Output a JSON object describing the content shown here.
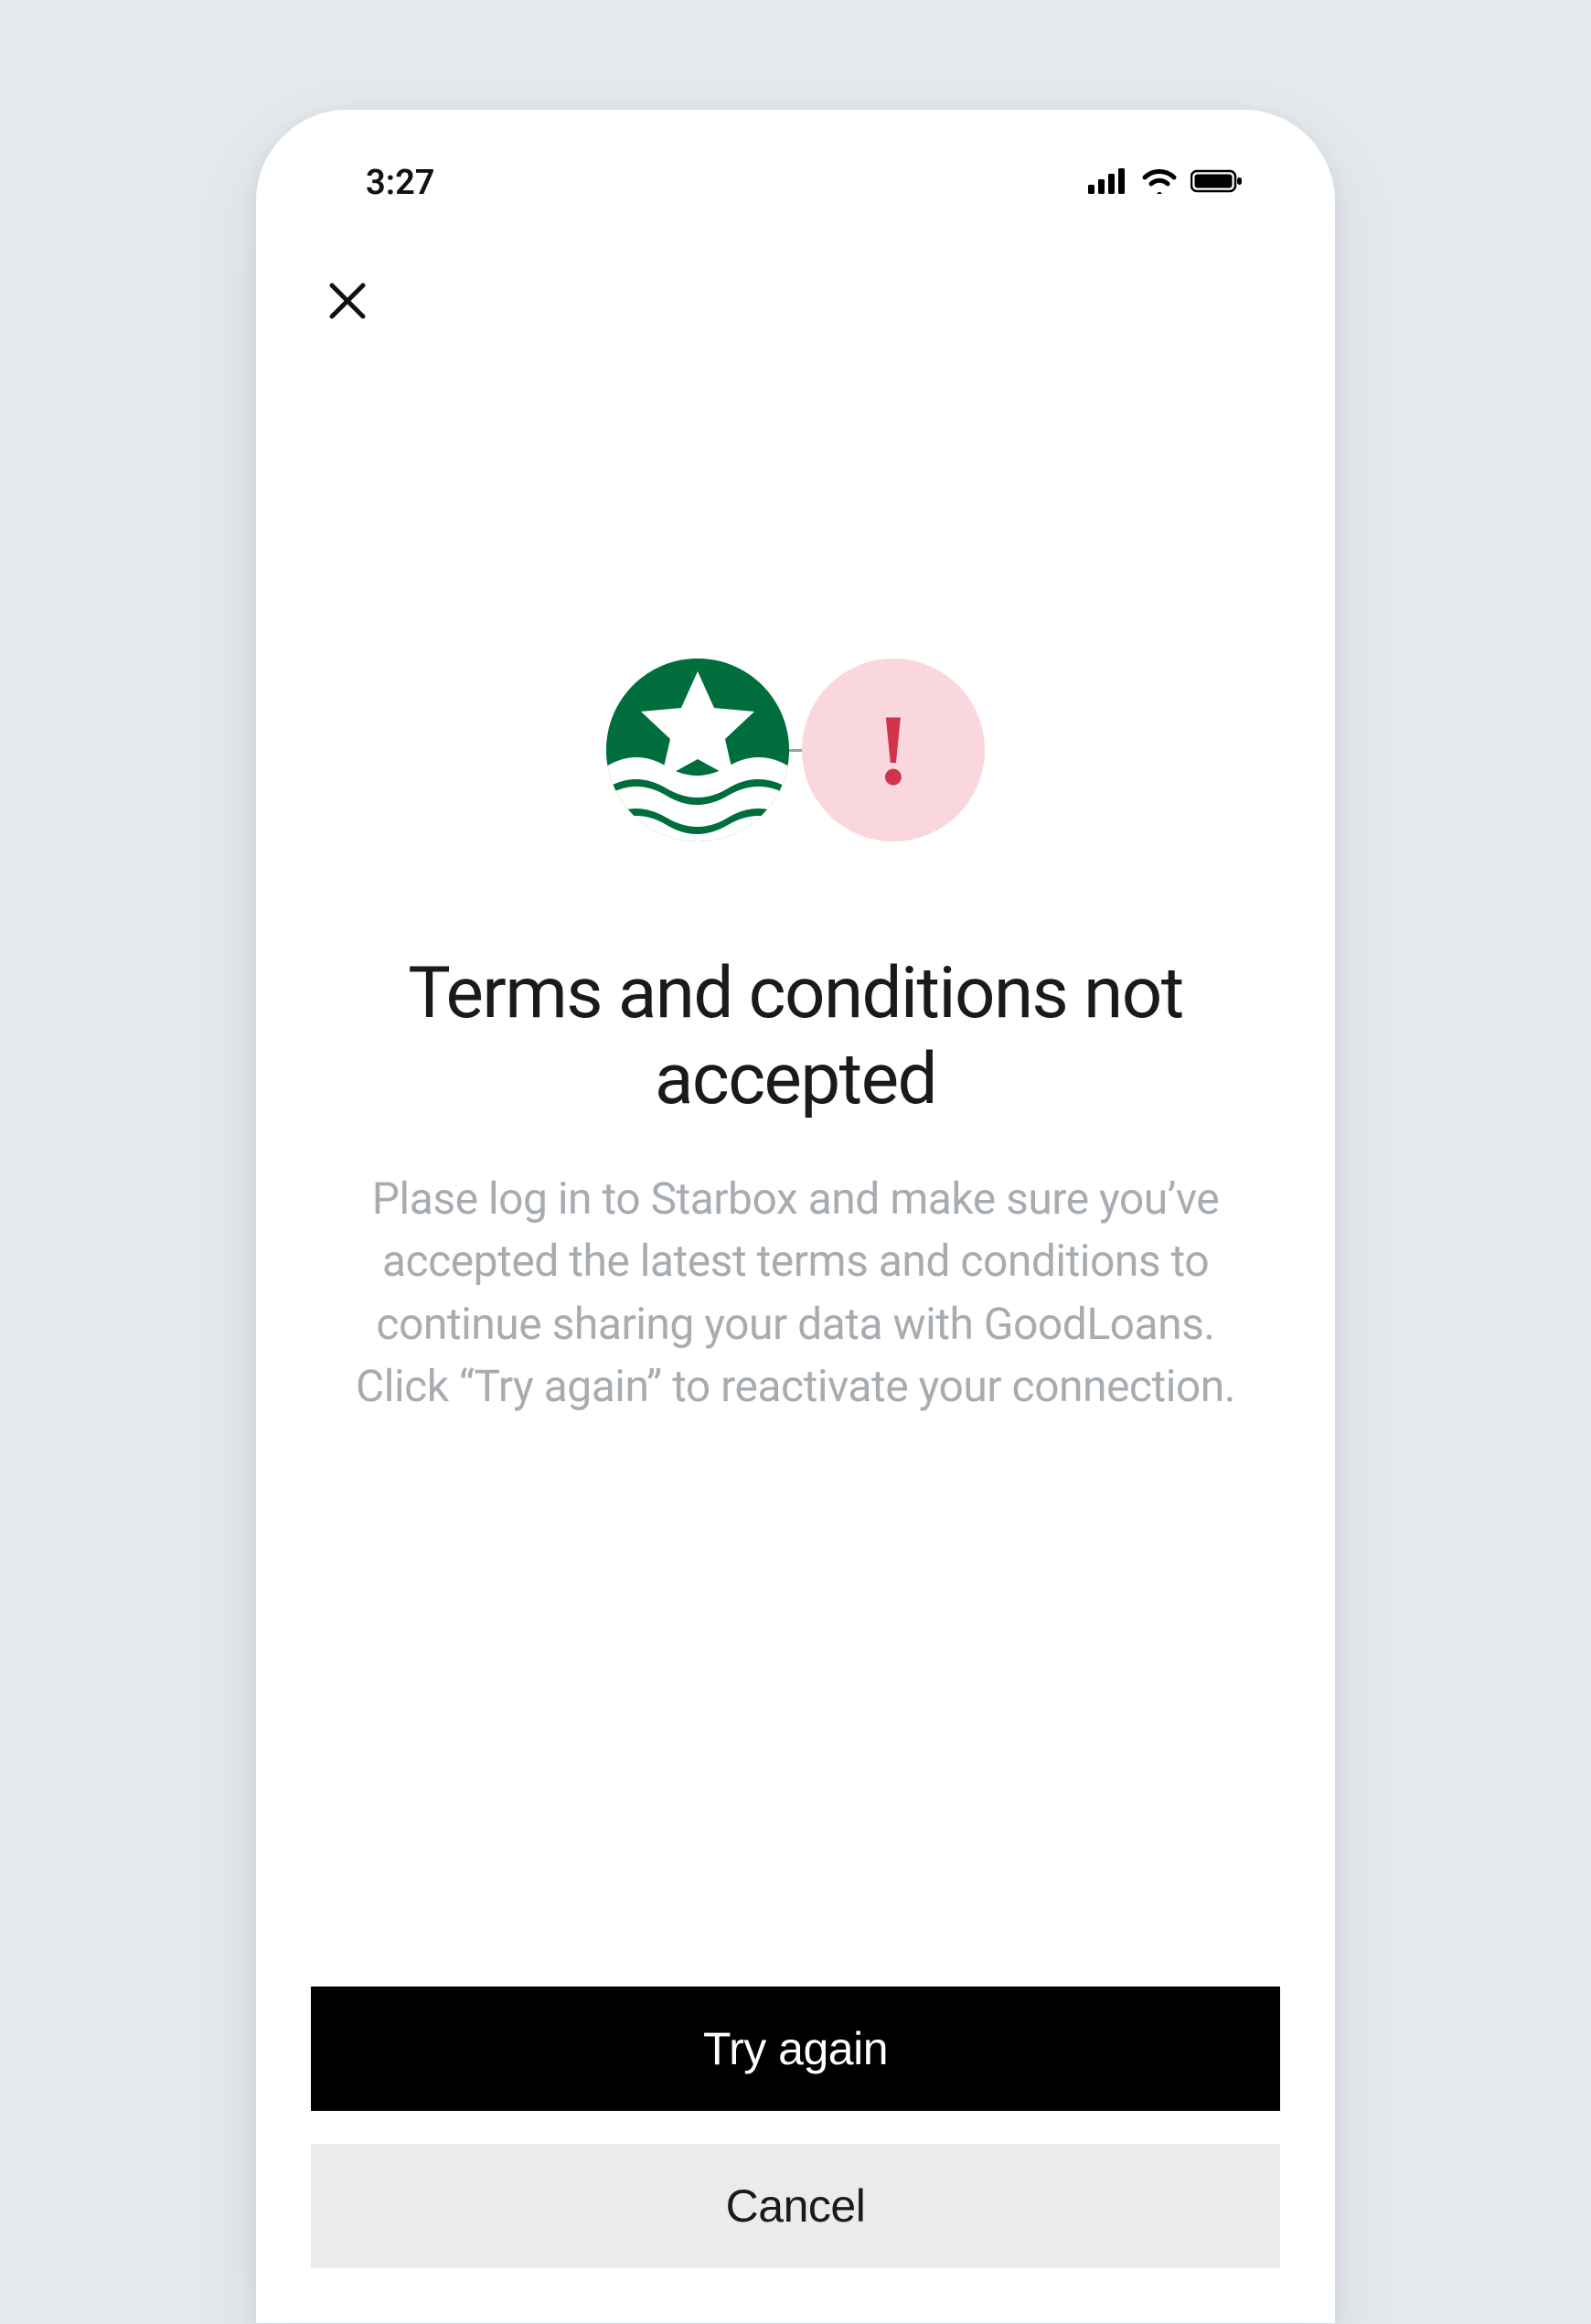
{
  "status_bar": {
    "time": "3:27"
  },
  "icons": {
    "brand": "starbox-logo",
    "alert": "exclamation-icon"
  },
  "content": {
    "title": "Terms and conditions not accepted",
    "body": "Plase log in to Starbox and make sure you’ve accepted the latest terms and conditions to continue sharing your data with GoodLoans. Click “Try again” to reactivate your connection."
  },
  "buttons": {
    "primary": "Try again",
    "secondary": "Cancel"
  },
  "colors": {
    "brand_green": "#006e3c",
    "alert_bg": "#fad7dd",
    "alert_fg": "#d1334a",
    "page_bg": "#e4e9ee"
  }
}
